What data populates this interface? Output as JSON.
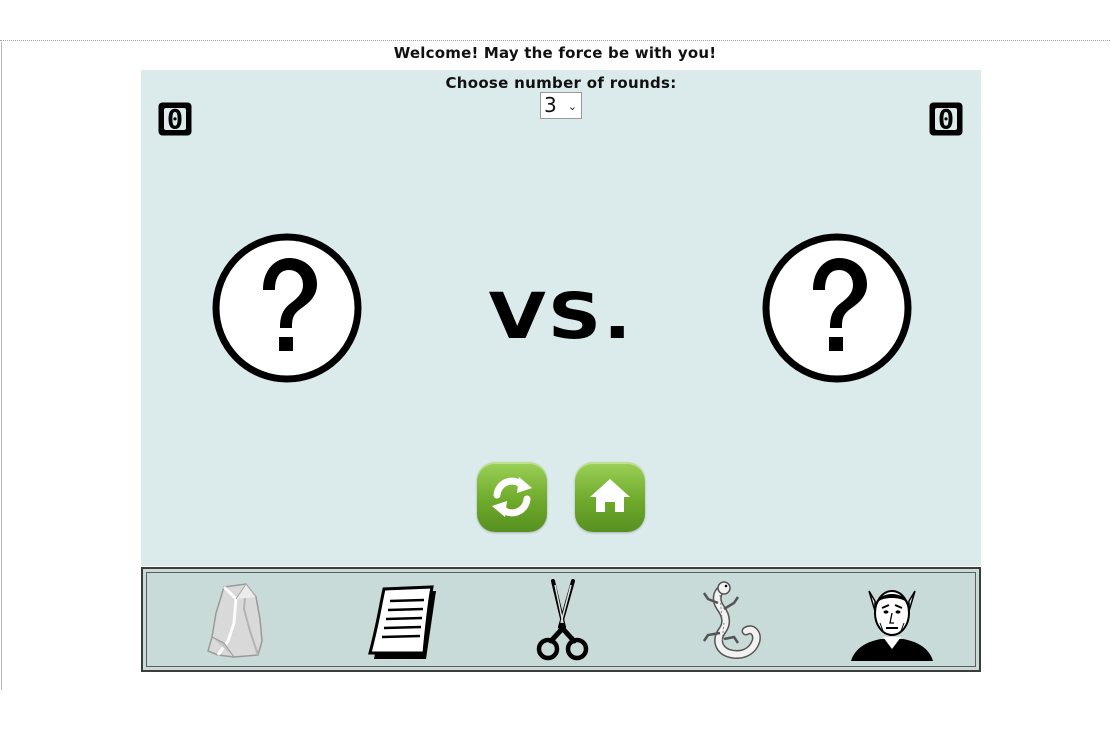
{
  "header": {
    "welcome": "Welcome! May the force be with you!"
  },
  "rounds": {
    "label": "Choose number of rounds:",
    "selected": "3"
  },
  "scores": {
    "player": "0",
    "computer": "0"
  },
  "versus": "VS.",
  "buttons": {
    "restart_icon": "refresh-icon",
    "home_icon": "home-icon"
  },
  "choices": [
    {
      "id": "rock",
      "icon": "rock-icon"
    },
    {
      "id": "paper",
      "icon": "paper-icon"
    },
    {
      "id": "scissors",
      "icon": "scissors-icon"
    },
    {
      "id": "lizard",
      "icon": "lizard-icon"
    },
    {
      "id": "spock",
      "icon": "spock-icon"
    }
  ],
  "colors": {
    "board": "#dbebeb",
    "tray": "#c8dbd9",
    "button_green": "#6faa2c"
  }
}
